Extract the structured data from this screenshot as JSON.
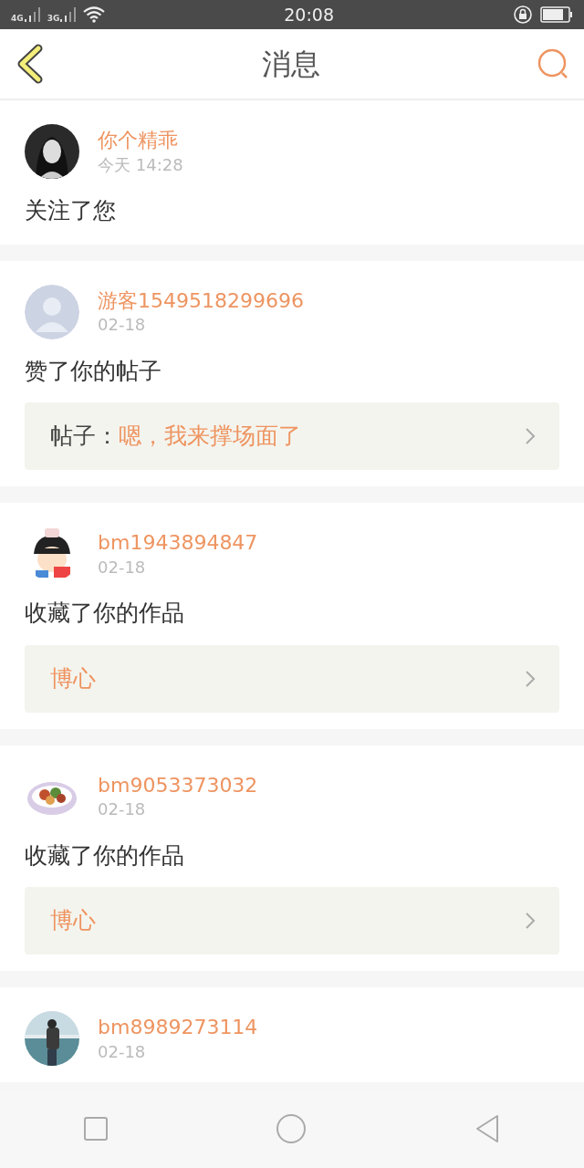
{
  "status_bar": {
    "network_1": "4G",
    "network_2": "3G",
    "time": "20:08"
  },
  "header": {
    "title": "消息"
  },
  "messages": [
    {
      "avatar": {
        "kind": "person"
      },
      "name": "你个精乖",
      "time": "今天 14:28",
      "action": "关注了您"
    },
    {
      "avatar": {
        "kind": "default"
      },
      "name": "游客1549518299696",
      "time": "02-18",
      "action": "赞了你的帖子",
      "attachment": {
        "label": "帖子：",
        "title": "嗯，我来撑场面了"
      }
    },
    {
      "avatar": {
        "kind": "cartoon"
      },
      "name": "bm1943894847",
      "time": "02-18",
      "action": "收藏了你的作品",
      "attachment": {
        "title": "博心"
      }
    },
    {
      "avatar": {
        "kind": "food"
      },
      "name": "bm9053373032",
      "time": "02-18",
      "action": "收藏了你的作品",
      "attachment": {
        "title": "博心"
      }
    },
    {
      "avatar": {
        "kind": "seaside"
      },
      "name": "bm8989273114",
      "time": "02-18"
    }
  ]
}
